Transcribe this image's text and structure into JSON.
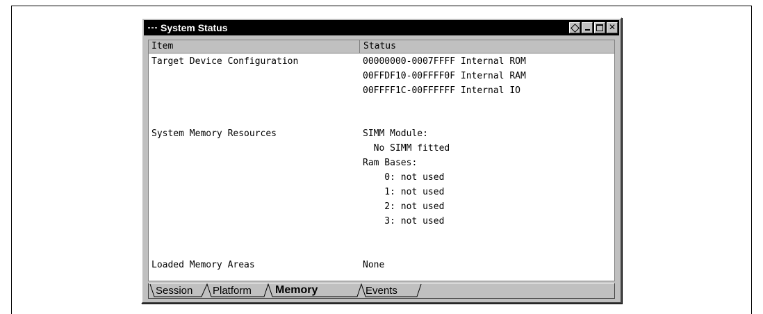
{
  "window": {
    "title": "System Status"
  },
  "table": {
    "columns": [
      "Item",
      "Status"
    ],
    "rows": [
      {
        "item": "Target Device Configuration",
        "status": [
          "00000000-0007FFFF Internal ROM",
          "00FFDF10-00FFFF0F Internal RAM",
          "00FFFF1C-00FFFFFF Internal IO"
        ]
      },
      {
        "item": "System Memory Resources",
        "status": [
          "SIMM Module:",
          "  No SIMM fitted",
          "Ram Bases:",
          "    0: not used",
          "    1: not used",
          "    2: not used",
          "    3: not used"
        ]
      },
      {
        "item": "Loaded Memory Areas",
        "status": [
          "None"
        ]
      }
    ]
  },
  "tabs": [
    {
      "label": "Session",
      "active": false
    },
    {
      "label": "Platform",
      "active": false
    },
    {
      "label": "Memory",
      "active": true
    },
    {
      "label": "Events",
      "active": false
    }
  ],
  "colors": {
    "titlebar": "#000000",
    "face": "#c0c0c0",
    "content_bg": "#ffffff"
  }
}
